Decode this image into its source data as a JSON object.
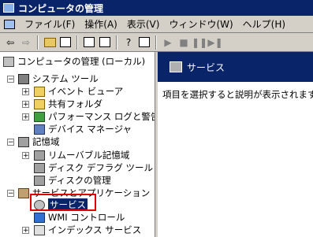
{
  "window": {
    "title": "コンピュータの管理"
  },
  "menu": [
    "ファイル(F)",
    "操作(A)",
    "表示(V)",
    "ウィンドウ(W)",
    "ヘルプ(H)"
  ],
  "toolbar": {
    "buttons": [
      "back-arrow",
      "forward-arrow",
      "up-folder",
      "show-tree",
      "refresh",
      "export-list",
      "help",
      "properties",
      "play",
      "stop",
      "pause",
      "restart"
    ]
  },
  "tree": {
    "root": "コンピュータの管理 (ローカル)",
    "system_tools": "システム ツール",
    "event_viewer": "イベント ビューア",
    "shared_folders": "共有フォルダ",
    "perf_logs": "パフォーマンス ログと警告",
    "device_manager": "デバイス マネージャ",
    "storage": "記憶域",
    "removable_storage": "リムーバブル記憶域",
    "disk_defrag": "ディスク デフラグ ツール",
    "disk_management": "ディスクの管理",
    "services_apps": "サービスとアプリケーション",
    "services": "サービス",
    "wmi_control": "WMI コントロール",
    "indexing_service": "インデックス サービス"
  },
  "details": {
    "header": "サービス",
    "message": "項目を選択すると説明が表示されます。"
  },
  "colors": {
    "titlebar": "#0a246a",
    "selection": "#0a246a",
    "highlight_box": "#e00000",
    "chrome": "#d4d0c8"
  }
}
